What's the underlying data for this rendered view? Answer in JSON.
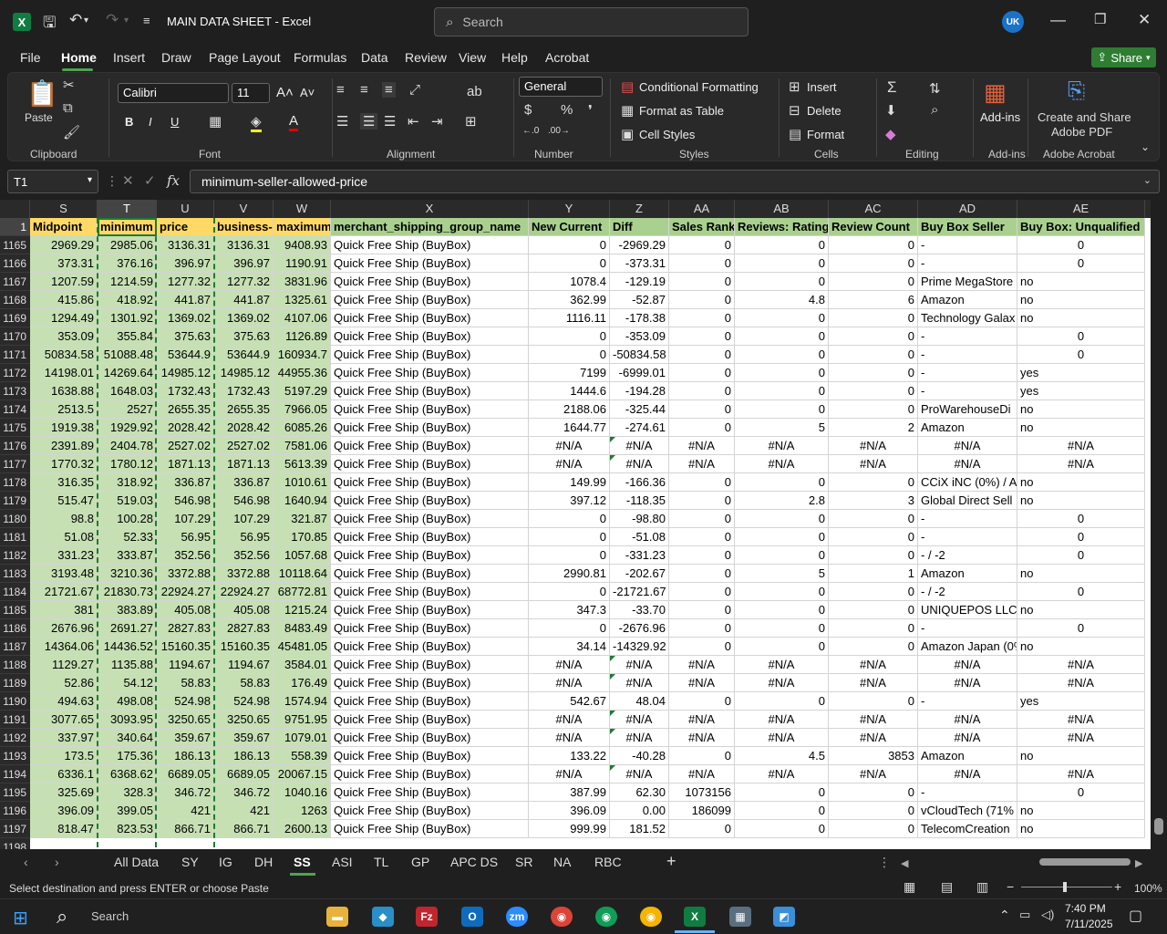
{
  "window": {
    "title": "MAIN DATA SHEET  -  Excel",
    "search_placeholder": "Search",
    "user_initials": "UK"
  },
  "menu": [
    "File",
    "Home",
    "Insert",
    "Draw",
    "Page Layout",
    "Formulas",
    "Data",
    "Review",
    "View",
    "Help",
    "Acrobat"
  ],
  "share_label": "Share",
  "ribbon": {
    "paste": "Paste",
    "clipboard": "Clipboard",
    "font_name": "Calibri",
    "font_size": "11",
    "font": "Font",
    "alignment": "Alignment",
    "number_format": "General",
    "number": "Number",
    "cond_format": "Conditional Formatting",
    "format_table": "Format as Table",
    "cell_styles": "Cell Styles",
    "styles": "Styles",
    "insert": "Insert",
    "delete": "Delete",
    "format": "Format",
    "cells": "Cells",
    "editing": "Editing",
    "addins_btn": "Add-ins",
    "addins": "Add-ins",
    "create_share_1": "Create and Share",
    "create_share_2": "Adobe PDF",
    "adobe": "Adobe Acrobat"
  },
  "formula": {
    "namebox": "T1",
    "fx": "fx",
    "content": "minimum-seller-allowed-price"
  },
  "columns": [
    "S",
    "T",
    "U",
    "V",
    "W",
    "X",
    "Y",
    "Z",
    "AA",
    "AB",
    "AC",
    "AD",
    "AE"
  ],
  "headers": [
    "Midpoint",
    "minimum",
    "price",
    "business-",
    "maximum",
    "merchant_shipping_group_name",
    "New Current",
    "Diff",
    "Sales Rank",
    "Reviews: Rating",
    "Review Count",
    "Buy Box Seller",
    "Buy Box: Unqualified"
  ],
  "rows": [
    [
      "1165",
      "2969.29",
      "2985.06",
      "3136.31",
      "3136.31",
      "9408.93",
      "Quick Free Ship (BuyBox)",
      "0",
      "-2969.29",
      "0",
      "0",
      "0",
      "-",
      "0"
    ],
    [
      "1166",
      "373.31",
      "376.16",
      "396.97",
      "396.97",
      "1190.91",
      "Quick Free Ship (BuyBox)",
      "0",
      "-373.31",
      "0",
      "0",
      "0",
      "-",
      "0"
    ],
    [
      "1167",
      "1207.59",
      "1214.59",
      "1277.32",
      "1277.32",
      "3831.96",
      "Quick Free Ship (BuyBox)",
      "1078.4",
      "-129.19",
      "0",
      "0",
      "0",
      "Prime MegaStore",
      "no"
    ],
    [
      "1168",
      "415.86",
      "418.92",
      "441.87",
      "441.87",
      "1325.61",
      "Quick Free Ship (BuyBox)",
      "362.99",
      "-52.87",
      "0",
      "4.8",
      "6",
      "Amazon",
      "no"
    ],
    [
      "1169",
      "1294.49",
      "1301.92",
      "1369.02",
      "1369.02",
      "4107.06",
      "Quick Free Ship (BuyBox)",
      "1116.11",
      "-178.38",
      "0",
      "0",
      "0",
      "Technology Galax",
      "no"
    ],
    [
      "1170",
      "353.09",
      "355.84",
      "375.63",
      "375.63",
      "1126.89",
      "Quick Free Ship (BuyBox)",
      "0",
      "-353.09",
      "0",
      "0",
      "0",
      "-",
      "0"
    ],
    [
      "1171",
      "50834.58",
      "51088.48",
      "53644.9",
      "53644.9",
      "160934.7",
      "Quick Free Ship (BuyBox)",
      "0",
      "-50834.58",
      "0",
      "0",
      "0",
      "-",
      "0"
    ],
    [
      "1172",
      "14198.01",
      "14269.64",
      "14985.12",
      "14985.12",
      "44955.36",
      "Quick Free Ship (BuyBox)",
      "7199",
      "-6999.01",
      "0",
      "0",
      "0",
      "-",
      "yes"
    ],
    [
      "1173",
      "1638.88",
      "1648.03",
      "1732.43",
      "1732.43",
      "5197.29",
      "Quick Free Ship (BuyBox)",
      "1444.6",
      "-194.28",
      "0",
      "0",
      "0",
      "-",
      "yes"
    ],
    [
      "1174",
      "2513.5",
      "2527",
      "2655.35",
      "2655.35",
      "7966.05",
      "Quick Free Ship (BuyBox)",
      "2188.06",
      "-325.44",
      "0",
      "0",
      "0",
      "ProWarehouseDi",
      "no"
    ],
    [
      "1175",
      "1919.38",
      "1929.92",
      "2028.42",
      "2028.42",
      "6085.26",
      "Quick Free Ship (BuyBox)",
      "1644.77",
      "-274.61",
      "0",
      "5",
      "2",
      "Amazon",
      "no"
    ],
    [
      "1176",
      "2391.89",
      "2404.78",
      "2527.02",
      "2527.02",
      "7581.06",
      "Quick Free Ship (BuyBox)",
      "#N/A",
      "#N/A",
      "#N/A",
      "#N/A",
      "#N/A",
      "#N/A",
      "#N/A"
    ],
    [
      "1177",
      "1770.32",
      "1780.12",
      "1871.13",
      "1871.13",
      "5613.39",
      "Quick Free Ship (BuyBox)",
      "#N/A",
      "#N/A",
      "#N/A",
      "#N/A",
      "#N/A",
      "#N/A",
      "#N/A"
    ],
    [
      "1178",
      "316.35",
      "318.92",
      "336.87",
      "336.87",
      "1010.61",
      "Quick Free Ship (BuyBox)",
      "149.99",
      "-166.36",
      "0",
      "0",
      "0",
      "CCiX iNC (0%) / A",
      "no"
    ],
    [
      "1179",
      "515.47",
      "519.03",
      "546.98",
      "546.98",
      "1640.94",
      "Quick Free Ship (BuyBox)",
      "397.12",
      "-118.35",
      "0",
      "2.8",
      "3",
      "Global Direct Sell",
      "no"
    ],
    [
      "1180",
      "98.8",
      "100.28",
      "107.29",
      "107.29",
      "321.87",
      "Quick Free Ship (BuyBox)",
      "0",
      "-98.80",
      "0",
      "0",
      "0",
      "-",
      "0"
    ],
    [
      "1181",
      "51.08",
      "52.33",
      "56.95",
      "56.95",
      "170.85",
      "Quick Free Ship (BuyBox)",
      "0",
      "-51.08",
      "0",
      "0",
      "0",
      "-",
      "0"
    ],
    [
      "1182",
      "331.23",
      "333.87",
      "352.56",
      "352.56",
      "1057.68",
      "Quick Free Ship (BuyBox)",
      "0",
      "-331.23",
      "0",
      "0",
      "0",
      "- / -2",
      "0"
    ],
    [
      "1183",
      "3193.48",
      "3210.36",
      "3372.88",
      "3372.88",
      "10118.64",
      "Quick Free Ship (BuyBox)",
      "2990.81",
      "-202.67",
      "0",
      "5",
      "1",
      "Amazon",
      "no"
    ],
    [
      "1184",
      "21721.67",
      "21830.73",
      "22924.27",
      "22924.27",
      "68772.81",
      "Quick Free Ship (BuyBox)",
      "0",
      "-21721.67",
      "0",
      "0",
      "0",
      "- / -2",
      "0"
    ],
    [
      "1185",
      "381",
      "383.89",
      "405.08",
      "405.08",
      "1215.24",
      "Quick Free Ship (BuyBox)",
      "347.3",
      "-33.70",
      "0",
      "0",
      "0",
      "UNIQUEPOS LLC (",
      "no"
    ],
    [
      "1186",
      "2676.96",
      "2691.27",
      "2827.83",
      "2827.83",
      "8483.49",
      "Quick Free Ship (BuyBox)",
      "0",
      "-2676.96",
      "0",
      "0",
      "0",
      "-",
      "0"
    ],
    [
      "1187",
      "14364.06",
      "14436.52",
      "15160.35",
      "15160.35",
      "45481.05",
      "Quick Free Ship (BuyBox)",
      "34.14",
      "-14329.92",
      "0",
      "0",
      "0",
      "Amazon Japan (0%",
      "no"
    ],
    [
      "1188",
      "1129.27",
      "1135.88",
      "1194.67",
      "1194.67",
      "3584.01",
      "Quick Free Ship (BuyBox)",
      "#N/A",
      "#N/A",
      "#N/A",
      "#N/A",
      "#N/A",
      "#N/A",
      "#N/A"
    ],
    [
      "1189",
      "52.86",
      "54.12",
      "58.83",
      "58.83",
      "176.49",
      "Quick Free Ship (BuyBox)",
      "#N/A",
      "#N/A",
      "#N/A",
      "#N/A",
      "#N/A",
      "#N/A",
      "#N/A"
    ],
    [
      "1190",
      "494.63",
      "498.08",
      "524.98",
      "524.98",
      "1574.94",
      "Quick Free Ship (BuyBox)",
      "542.67",
      "48.04",
      "0",
      "0",
      "0",
      "-",
      "yes"
    ],
    [
      "1191",
      "3077.65",
      "3093.95",
      "3250.65",
      "3250.65",
      "9751.95",
      "Quick Free Ship (BuyBox)",
      "#N/A",
      "#N/A",
      "#N/A",
      "#N/A",
      "#N/A",
      "#N/A",
      "#N/A"
    ],
    [
      "1192",
      "337.97",
      "340.64",
      "359.67",
      "359.67",
      "1079.01",
      "Quick Free Ship (BuyBox)",
      "#N/A",
      "#N/A",
      "#N/A",
      "#N/A",
      "#N/A",
      "#N/A",
      "#N/A"
    ],
    [
      "1193",
      "173.5",
      "175.36",
      "186.13",
      "186.13",
      "558.39",
      "Quick Free Ship (BuyBox)",
      "133.22",
      "-40.28",
      "0",
      "4.5",
      "3853",
      "Amazon",
      "no"
    ],
    [
      "1194",
      "6336.1",
      "6368.62",
      "6689.05",
      "6689.05",
      "20067.15",
      "Quick Free Ship (BuyBox)",
      "#N/A",
      "#N/A",
      "#N/A",
      "#N/A",
      "#N/A",
      "#N/A",
      "#N/A"
    ],
    [
      "1195",
      "325.69",
      "328.3",
      "346.72",
      "346.72",
      "1040.16",
      "Quick Free Ship (BuyBox)",
      "387.99",
      "62.30",
      "1073156",
      "0",
      "0",
      "-",
      "0"
    ],
    [
      "1196",
      "396.09",
      "399.05",
      "421",
      "421",
      "1263",
      "Quick Free Ship (BuyBox)",
      "396.09",
      "0.00",
      "186099",
      "0",
      "0",
      "vCloudTech (71%",
      "no"
    ],
    [
      "1197",
      "818.47",
      "823.53",
      "866.71",
      "866.71",
      "2600.13",
      "Quick Free Ship (BuyBox)",
      "999.99",
      "181.52",
      "0",
      "0",
      "0",
      "TelecomCreation",
      "no"
    ]
  ],
  "next_row": "1198",
  "sheets": [
    "All Data",
    "SY",
    "IG",
    "DH",
    "SS",
    "ASI",
    "TL",
    "GP",
    "APC DS",
    "SR",
    "NA",
    "RBC"
  ],
  "active_sheet": "SS",
  "status": {
    "message": "Select destination and press ENTER or choose Paste",
    "zoom": "100%"
  },
  "taskbar": {
    "search": "Search",
    "time": "7:40 PM",
    "date": "7/11/2025"
  }
}
